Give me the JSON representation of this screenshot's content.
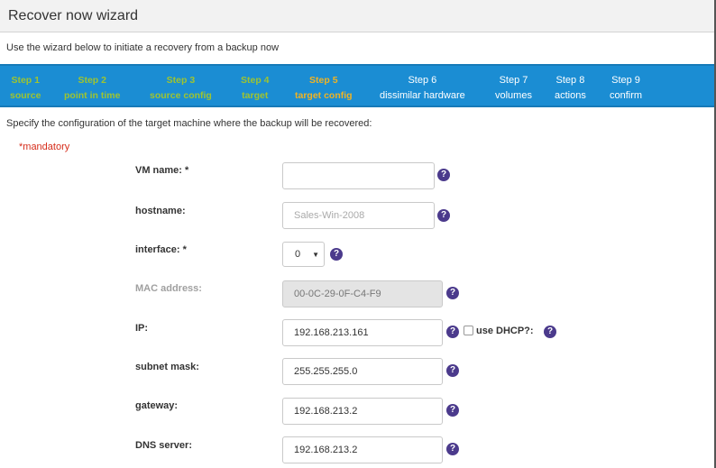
{
  "wizard": {
    "title": "Recover now wizard",
    "intro": "Use the wizard below to initiate a recovery from a backup now"
  },
  "steps": [
    {
      "line1": "Step 1",
      "line2": "source",
      "state": "done"
    },
    {
      "line1": "Step 2",
      "line2": "point in time",
      "state": "done"
    },
    {
      "line1": "Step 3",
      "line2": "source config",
      "state": "done"
    },
    {
      "line1": "Step 4",
      "line2": "target",
      "state": "done"
    },
    {
      "line1": "Step 5",
      "line2": "target config",
      "state": "current"
    },
    {
      "line1": "Step 6",
      "line2": "dissimilar hardware",
      "state": "todo"
    },
    {
      "line1": "Step 7",
      "line2": "volumes",
      "state": "todo"
    },
    {
      "line1": "Step 8",
      "line2": "actions",
      "state": "todo"
    },
    {
      "line1": "Step 9",
      "line2": "confirm",
      "state": "todo"
    }
  ],
  "colors": {
    "steps_bar": "#1b8dd3",
    "step_done": "#9fc430",
    "step_current": "#f0b323",
    "step_todo": "#ffffff",
    "mandatory": "#d62c1a",
    "help_icon": "#4b3a8c"
  },
  "form": {
    "description": "Specify the configuration of the target machine where the backup will be recovered:",
    "mandatory_note": "*mandatory",
    "vm_name": {
      "label": "VM name: *",
      "value": ""
    },
    "hostname": {
      "label": "hostname:",
      "placeholder": "Sales-Win-2008"
    },
    "interface": {
      "label": "interface: *",
      "value": "0"
    },
    "mac_address": {
      "label": "MAC address:",
      "value": "00-0C-29-0F-C4-F9"
    },
    "ip": {
      "label": "IP:",
      "value": "192.168.213.161"
    },
    "use_dhcp": {
      "label": "use DHCP?:",
      "checked": false
    },
    "subnet_mask": {
      "label": "subnet mask:",
      "value": "255.255.255.0"
    },
    "gateway": {
      "label": "gateway:",
      "value": "192.168.213.2"
    },
    "dns_server": {
      "label": "DNS server:",
      "value": "192.168.213.2"
    }
  },
  "icons": {
    "help": "question-circle-icon",
    "help_glyph": "?",
    "caret": "▼"
  }
}
